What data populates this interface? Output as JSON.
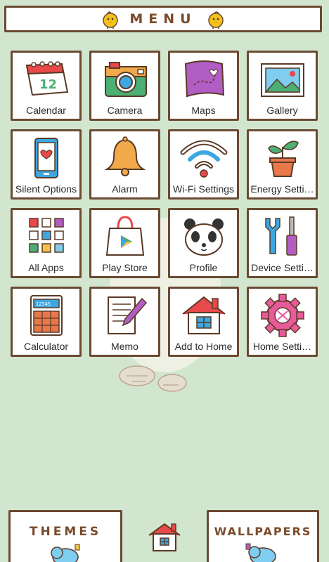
{
  "header": {
    "title": "MENU"
  },
  "tiles": [
    {
      "label": "Calendar",
      "icon": "calendar-icon"
    },
    {
      "label": "Camera",
      "icon": "camera-icon"
    },
    {
      "label": "Maps",
      "icon": "map-icon"
    },
    {
      "label": "Gallery",
      "icon": "picture-icon"
    },
    {
      "label": "Silent Options",
      "icon": "phone-heart-icon"
    },
    {
      "label": "Alarm",
      "icon": "bell-icon"
    },
    {
      "label": "Wi-Fi Settings",
      "icon": "wifi-icon"
    },
    {
      "label": "Energy Setti…",
      "icon": "plant-icon"
    },
    {
      "label": "All Apps",
      "icon": "apps-grid-icon"
    },
    {
      "label": "Play Store",
      "icon": "shopping-bag-icon"
    },
    {
      "label": "Profile",
      "icon": "panda-icon"
    },
    {
      "label": "Device Setti…",
      "icon": "tools-icon"
    },
    {
      "label": "Calculator",
      "icon": "calculator-icon"
    },
    {
      "label": "Memo",
      "icon": "memo-icon"
    },
    {
      "label": "Add to Home",
      "icon": "house-icon"
    },
    {
      "label": "Home Setti…",
      "icon": "gear-icon"
    }
  ],
  "bottom": {
    "themes_label": "THEMES",
    "wallpapers_label": "WALLPAPERS"
  },
  "colors": {
    "background": "#d2e6cf",
    "frame": "#6a4a32",
    "title": "#7a4b2a"
  },
  "calendar_date": "12",
  "calculator_display": "12345"
}
